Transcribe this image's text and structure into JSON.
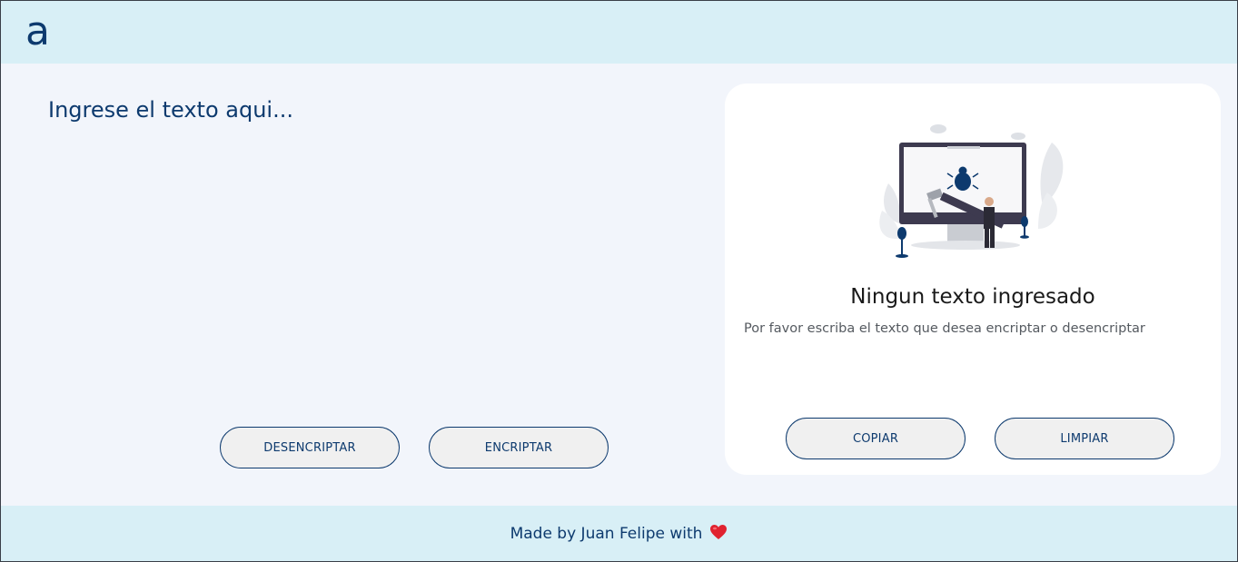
{
  "header": {
    "logo": "a"
  },
  "input": {
    "placeholder": "Ingrese el texto aqui..."
  },
  "actions": {
    "decrypt_label": "DESENCRIPTAR",
    "encrypt_label": "ENCRIPTAR"
  },
  "result_panel": {
    "title": "Ningun texto ingresado",
    "subtitle": "Por favor escriba el texto que desea encriptar o desencriptar",
    "copy_label": "COPIAR",
    "clear_label": "LIMPIAR",
    "illustration_icon": "computer-bug-repair-illustration"
  },
  "footer": {
    "text": "Made by Juan Felipe with",
    "icon": "heart-icon"
  },
  "colors": {
    "primary": "#0d3a6e",
    "header_bg": "#d8eff6",
    "page_bg": "#f2f5fb",
    "panel_bg": "#ffffff",
    "button_bg": "#f0f0f0"
  }
}
